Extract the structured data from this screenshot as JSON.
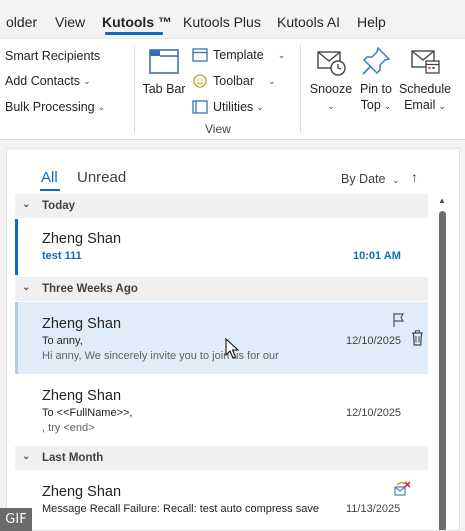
{
  "menu_tabs": [
    {
      "label": "older",
      "active": false
    },
    {
      "label": "View",
      "active": false
    },
    {
      "label": "Kutools ™",
      "active": true
    },
    {
      "label": "Kutools Plus",
      "active": false
    },
    {
      "label": "Kutools AI",
      "active": false
    },
    {
      "label": "Help",
      "active": false
    }
  ],
  "ribbon": {
    "left_items": [
      "Smart Recipients",
      "Add Contacts",
      "Bulk Processing"
    ],
    "tab_bar": "Tab Bar",
    "view_items": [
      "Template",
      "Toolbar",
      "Utilities"
    ],
    "view_group_label": "View",
    "snooze": "Snooze",
    "pin_to_top": [
      "Pin to",
      "Top"
    ],
    "schedule_email": [
      "Schedule",
      "Email"
    ]
  },
  "list": {
    "filter_all": "All",
    "filter_unread": "Unread",
    "sort_by": "By Date",
    "sort_direction": "↑",
    "groups": {
      "today": "Today",
      "three_weeks": "Three Weeks Ago",
      "last_month": "Last Month"
    },
    "messages": [
      {
        "sender": "Zheng Shan",
        "subject": "test 111",
        "preview": "",
        "time": "10:01 AM",
        "unread": true
      },
      {
        "sender": "Zheng Shan",
        "subject": "To anny,",
        "preview": "Hi anny,  We sincerely invite you to join us for our",
        "time": "12/10/2025",
        "selected": true
      },
      {
        "sender": "Zheng Shan",
        "subject": "To <<FullName>>,",
        "preview": ",   try <end>",
        "time": "12/10/2025"
      },
      {
        "sender": "Zheng Shan",
        "subject": "Message Recall Failure: Recall: test  auto compress save",
        "preview": "",
        "time": "11/13/2025"
      }
    ]
  },
  "badge": "GIF",
  "colors": {
    "accent": "#0f6cbd",
    "selected_bg": "#e0edf8",
    "group_bg": "#f0f0f0"
  }
}
